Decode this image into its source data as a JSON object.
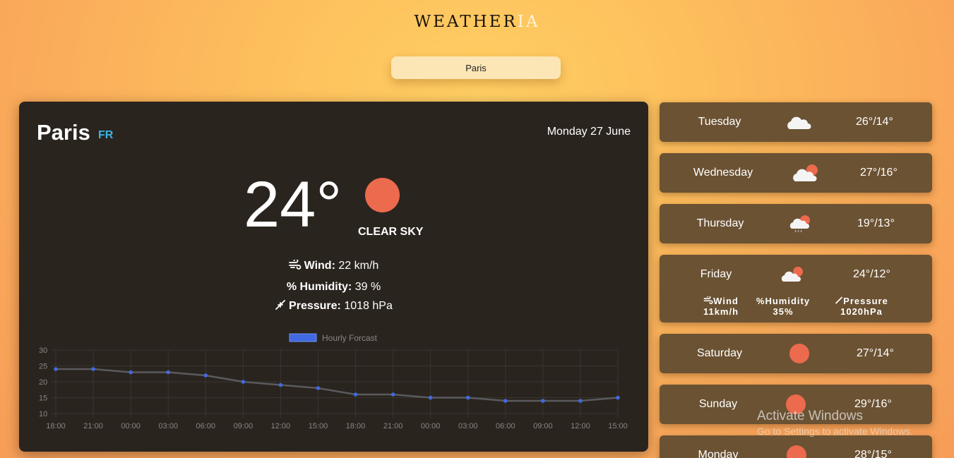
{
  "app": {
    "logo_dark": "WEATHER",
    "logo_light": "IA"
  },
  "search": {
    "value": "Paris"
  },
  "current": {
    "city": "Paris",
    "country": "FR",
    "date": "Monday 27 June",
    "temperature": "24°",
    "condition": "CLEAR SKY",
    "wind_label": "Wind:",
    "wind_value": "22 km/h",
    "humidity_label": "% Humidity:",
    "humidity_value": "39 %",
    "pressure_label": "Pressure:",
    "pressure_value": "1018 hPa",
    "icon": "sun-icon",
    "sun_color": "#ec6a4d"
  },
  "chart_data": {
    "type": "line",
    "legend": "Hourly Forcast",
    "series_color": "#4169e1",
    "x": [
      "18:00",
      "21:00",
      "00:00",
      "03:00",
      "06:00",
      "09:00",
      "12:00",
      "15:00",
      "18:00",
      "21:00",
      "00:00",
      "03:00",
      "06:00",
      "09:00",
      "12:00",
      "15:00"
    ],
    "y": [
      24,
      24,
      23,
      23,
      22,
      20,
      19,
      18,
      16,
      16,
      15,
      15,
      14,
      14,
      14,
      15
    ],
    "yticks": [
      30,
      25,
      20,
      15,
      10
    ],
    "ylim": [
      10,
      30
    ],
    "grid": true
  },
  "forecast": [
    {
      "day": "Tuesday",
      "temp": "26°/14°",
      "icon": "cloud-icon"
    },
    {
      "day": "Wednesday",
      "temp": "27°/16°",
      "icon": "cloud-sun-icon"
    },
    {
      "day": "Thursday",
      "temp": "19°/13°",
      "icon": "cloud-sun-rain-icon"
    },
    {
      "day": "Friday",
      "temp": "24°/12°",
      "icon": "cloud-sun-icon",
      "wind_label": "Wind",
      "wind_value": "11km/h",
      "humidity_label": "%Humidity",
      "humidity_value": "35%",
      "pressure_label": "Pressure",
      "pressure_value": "1020hPa"
    },
    {
      "day": "Saturday",
      "temp": "27°/14°",
      "icon": "sun-icon"
    },
    {
      "day": "Sunday",
      "temp": "29°/16°",
      "icon": "sun-icon"
    },
    {
      "day": "Monday",
      "temp": "28°/15°",
      "icon": "sun-icon"
    }
  ],
  "watermark": {
    "line1": "Activate Windows",
    "line2": "Go to Settings to activate Windows."
  }
}
